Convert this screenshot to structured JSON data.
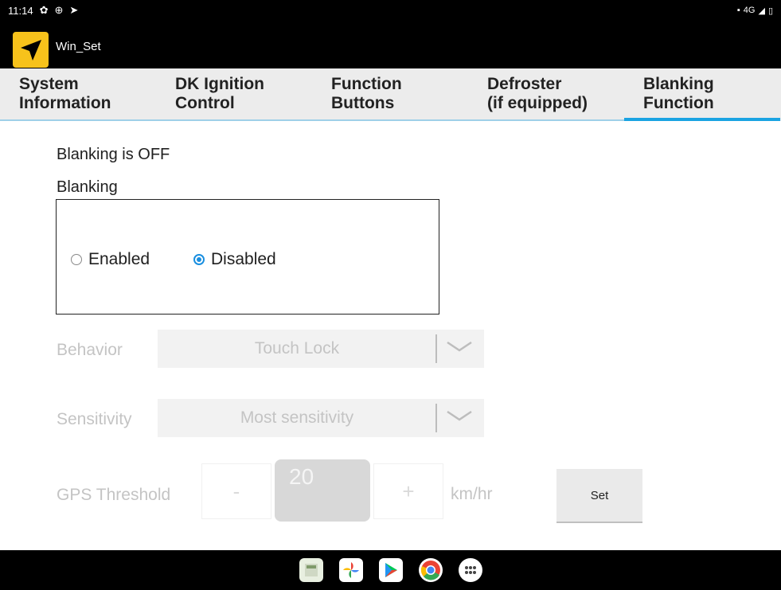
{
  "statusbar": {
    "time": "11:14",
    "network": "4G"
  },
  "app": {
    "title": "Win_Set",
    "accent": "#f7c21b"
  },
  "tabs": [
    {
      "line1": "System",
      "line2": "Information"
    },
    {
      "line1": "DK Ignition",
      "line2": "Control"
    },
    {
      "line1": "Function",
      "line2": "Buttons"
    },
    {
      "line1": "Defroster",
      "line2": "(if equipped)"
    },
    {
      "line1": "Blanking",
      "line2": "Function"
    }
  ],
  "active_tab": 4,
  "blanking": {
    "status": "Blanking is OFF",
    "section_label": "Blanking",
    "options": [
      {
        "label": "Enabled",
        "selected": false
      },
      {
        "label": "Disabled",
        "selected": true
      }
    ]
  },
  "behavior": {
    "label": "Behavior",
    "value": "Touch Lock"
  },
  "sensitivity": {
    "label": "Sensitivity",
    "value": "Most sensitivity"
  },
  "gps": {
    "label": "GPS Threshold",
    "minus": "-",
    "value": "20",
    "plus": "+",
    "unit": "km/hr",
    "set_label": "Set"
  },
  "dock": [
    "calculator-icon",
    "photos-icon",
    "play-store-icon",
    "chrome-icon",
    "apps-icon"
  ],
  "colors": {
    "tab_active_underline": "#1aa3e2",
    "radio_selected": "#1a8fe0"
  }
}
